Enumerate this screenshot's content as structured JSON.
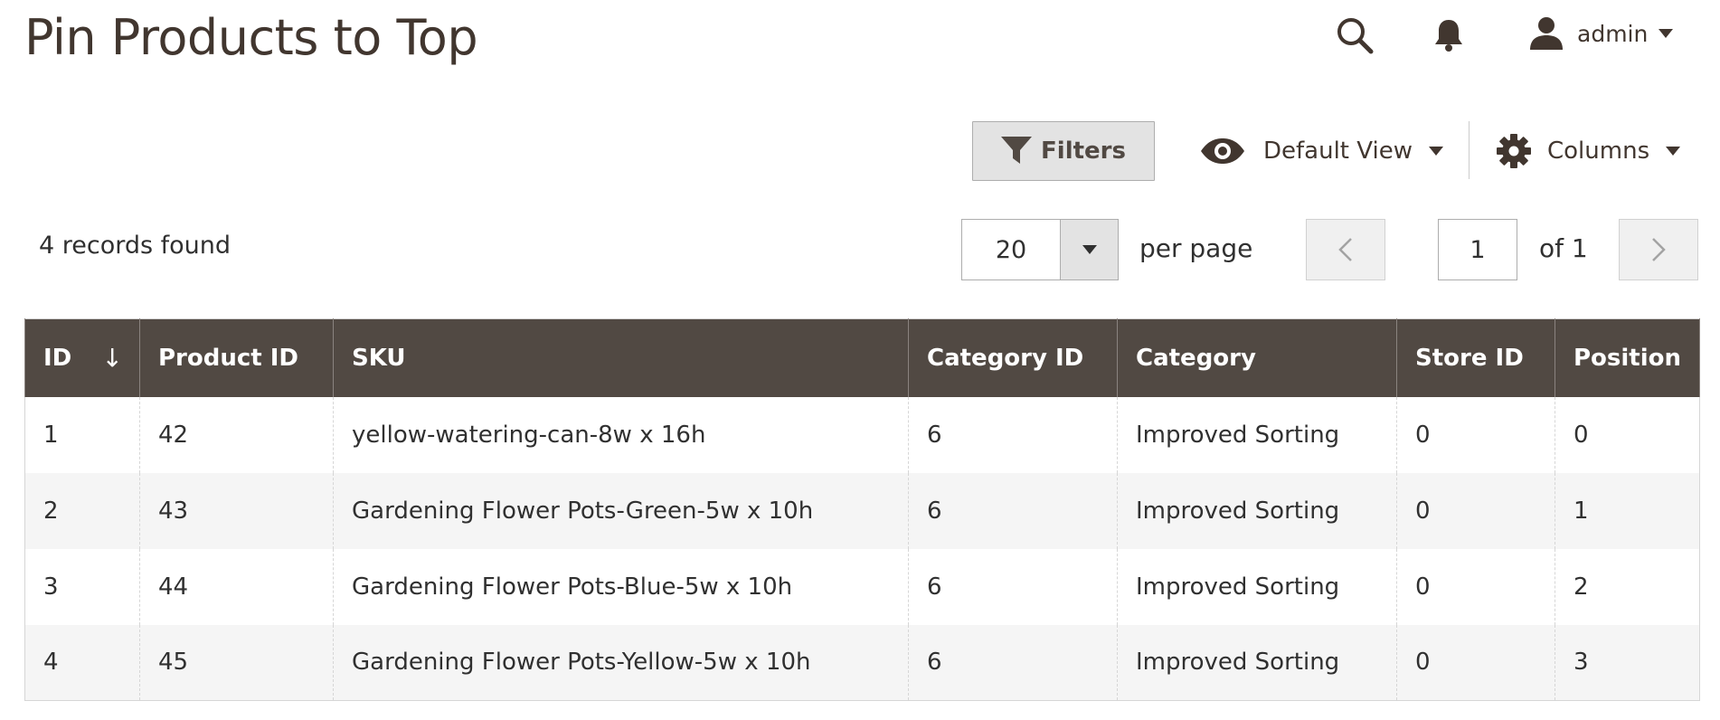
{
  "header": {
    "title": "Pin Products to Top",
    "user_name": "admin",
    "icons": [
      "search-icon",
      "bell-icon",
      "user-icon",
      "chevron-down-icon"
    ]
  },
  "toolbar": {
    "filters_label": "Filters",
    "view_label": "Default View",
    "columns_label": "Columns"
  },
  "pager": {
    "records_found": "4 records found",
    "per_page_value": "20",
    "per_page_label": "per page",
    "current_page": "1",
    "of_pages": "of 1"
  },
  "grid": {
    "columns": [
      "ID",
      "Product ID",
      "SKU",
      "Category ID",
      "Category",
      "Store ID",
      "Position"
    ],
    "sort_indicator": "↓",
    "rows": [
      [
        "1",
        "42",
        "yellow-watering-can-8w x 16h",
        "6",
        "Improved Sorting",
        "0",
        "0"
      ],
      [
        "2",
        "43",
        "Gardening Flower Pots-Green-5w x 10h",
        "6",
        "Improved Sorting",
        "0",
        "1"
      ],
      [
        "3",
        "44",
        "Gardening Flower Pots-Blue-5w x 10h",
        "6",
        "Improved Sorting",
        "0",
        "2"
      ],
      [
        "4",
        "45",
        "Gardening Flower Pots-Yellow-5w x 10h",
        "6",
        "Improved Sorting",
        "0",
        "3"
      ]
    ]
  },
  "colors": {
    "header_bg": "#514943",
    "title_text": "#41362f",
    "button_bg": "#e3e3e3",
    "row_alt_bg": "#f5f5f5"
  }
}
